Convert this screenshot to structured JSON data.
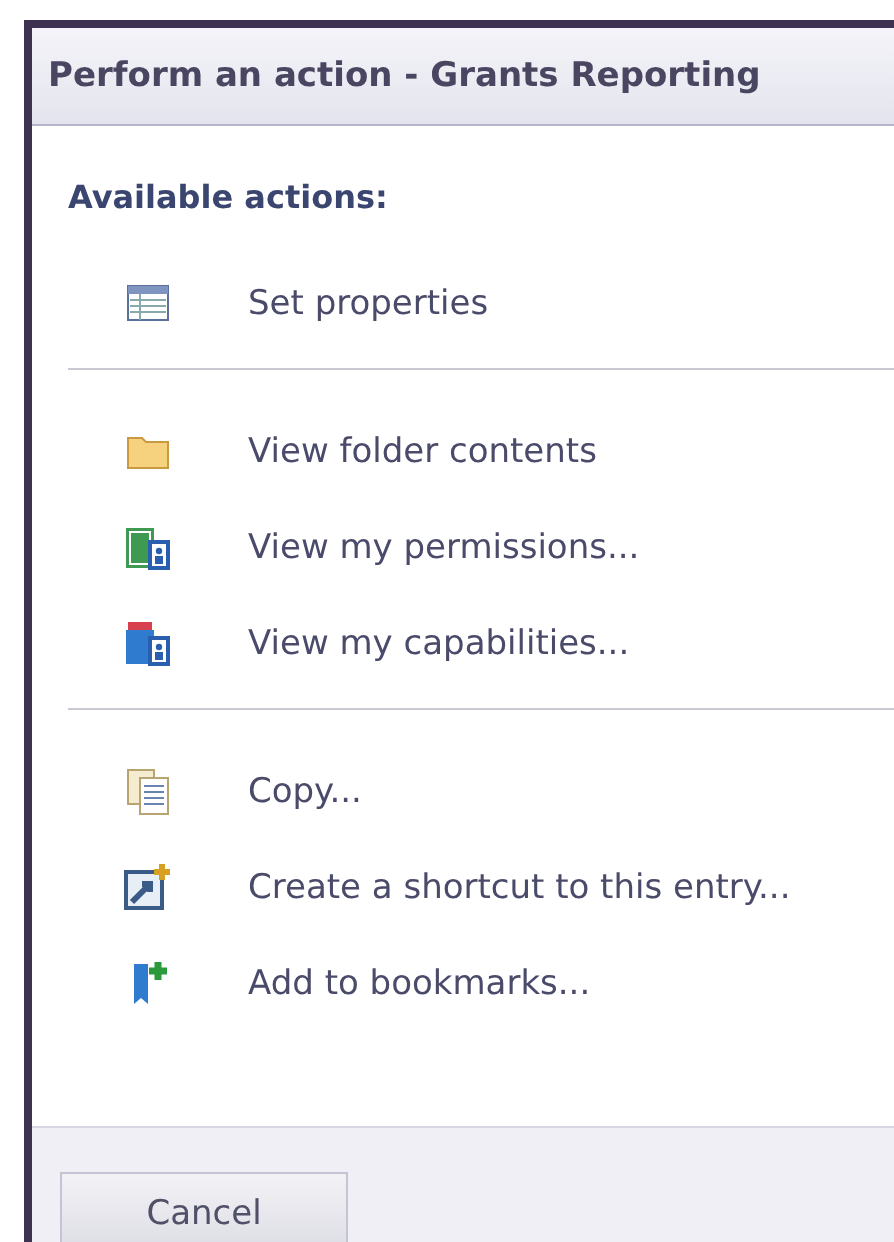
{
  "window": {
    "title": "Perform an action - Grants Reporting"
  },
  "heading": "Available actions:",
  "groups": [
    {
      "items": [
        {
          "kind": "properties",
          "label": "Set properties"
        }
      ]
    },
    {
      "items": [
        {
          "kind": "folder",
          "label": "View folder contents"
        },
        {
          "kind": "permissions",
          "label": "View my permissions..."
        },
        {
          "kind": "capabilities",
          "label": "View my capabilities..."
        }
      ]
    },
    {
      "items": [
        {
          "kind": "copy",
          "label": "Copy..."
        },
        {
          "kind": "shortcut",
          "label": "Create a shortcut to this entry..."
        },
        {
          "kind": "bookmark",
          "label": "Add to bookmarks..."
        }
      ]
    }
  ],
  "buttons": [
    "Cancel"
  ]
}
